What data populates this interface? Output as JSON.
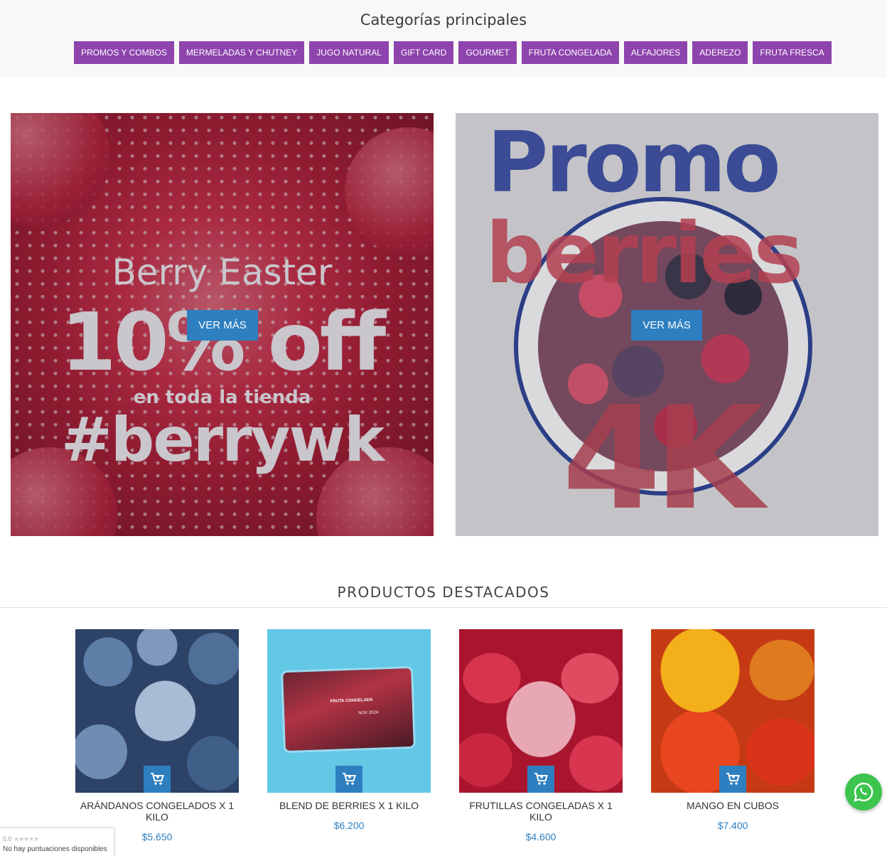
{
  "categories": {
    "title": "Categorías principales",
    "items": [
      "PROMOS Y COMBOS",
      "MERMELADAS Y CHUTNEY",
      "JUGO NATURAL",
      "GIFT CARD",
      "GOURMET",
      "FRUTA CONGELADA",
      "ALFAJORES",
      "ADEREZO",
      "FRUTA FRESCA"
    ]
  },
  "banners": {
    "left": {
      "line1": "Berry Easter",
      "line2": "10% off",
      "line3": "en toda la tienda",
      "line4": "#berrywk",
      "button": "VER MÁS"
    },
    "right": {
      "line1": "Promo",
      "line2": "berries",
      "line3": "4K",
      "button": "VER MÁS"
    }
  },
  "featured": {
    "title": "PRODUCTOS DESTACADOS",
    "products": [
      {
        "name": "ARÁNDANOS CONGELADOS X 1 KILO",
        "price": "$5.650"
      },
      {
        "name": "BLEND DE BERRIES X 1 KILO",
        "price": "$6.200"
      },
      {
        "name": "FRUTILLAS CONGELADAS X 1 KILO",
        "price": "$4.600"
      },
      {
        "name": "MANGO EN CUBOS",
        "price": "$7.400"
      }
    ]
  },
  "bag_label": {
    "line1": "FRUTA CONGELADA",
    "line2": "NOV 2024"
  },
  "rating_widget": {
    "score": "0.0",
    "stars": "★★★★★",
    "text": "No hay puntuaciones disponibles"
  },
  "icons": {
    "cart": "cart-icon",
    "whatsapp": "whatsapp-icon"
  },
  "colors": {
    "category_button": "#8e44ad",
    "accent_blue": "#2e7fc0",
    "whatsapp_green": "#3cc44e"
  }
}
